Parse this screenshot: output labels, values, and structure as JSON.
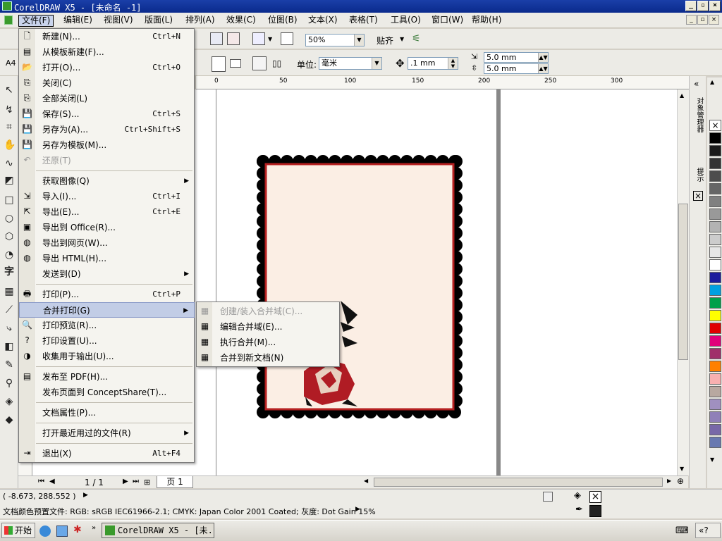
{
  "window": {
    "title": "CorelDRAW X5 - [未命名 -1]"
  },
  "menubar": [
    "文件(F)",
    "编辑(E)",
    "视图(V)",
    "版面(L)",
    "排列(A)",
    "效果(C)",
    "位图(B)",
    "文本(X)",
    "表格(T)",
    "工具(O)",
    "窗口(W)",
    "帮助(H)"
  ],
  "toolbar1": {
    "zoom": "50%",
    "snap_label": "贴齐"
  },
  "toolbar2": {
    "page_size": "A4",
    "units_label": "单位:",
    "units_value": "毫米",
    "nudge": ".1 mm",
    "dup_x": "5.0 mm",
    "dup_y": "5.0 mm"
  },
  "ruler_top_labels": [
    "0",
    "50",
    "100",
    "150",
    "200",
    "250",
    "300"
  ],
  "file_menu": [
    {
      "label": "新建(N)...",
      "shortcut": "Ctrl+N"
    },
    {
      "label": "从模板新建(F)..."
    },
    {
      "label": "打开(O)...",
      "shortcut": "Ctrl+O"
    },
    {
      "label": "关闭(C)"
    },
    {
      "label": "全部关闭(L)"
    },
    {
      "label": "保存(S)...",
      "shortcut": "Ctrl+S"
    },
    {
      "label": "另存为(A)...",
      "shortcut": "Ctrl+Shift+S"
    },
    {
      "label": "另存为模板(M)..."
    },
    {
      "label": "还原(T)",
      "disabled": true
    },
    {
      "label": "获取图像(Q)",
      "submenu": true
    },
    {
      "label": "导入(I)...",
      "shortcut": "Ctrl+I"
    },
    {
      "label": "导出(E)...",
      "shortcut": "Ctrl+E"
    },
    {
      "label": "导出到 Office(R)..."
    },
    {
      "label": "导出到网页(W)..."
    },
    {
      "label": "导出 HTML(H)..."
    },
    {
      "label": "发送到(D)",
      "submenu": true
    },
    {
      "label": "打印(P)...",
      "shortcut": "Ctrl+P"
    },
    {
      "label": "合并打印(G)",
      "submenu": true,
      "highlighted": true
    },
    {
      "label": "打印预览(R)..."
    },
    {
      "label": "打印设置(U)..."
    },
    {
      "label": "收集用于输出(U)..."
    },
    {
      "label": "发布至 PDF(H)..."
    },
    {
      "label": "发布页面到 ConceptShare(T)..."
    },
    {
      "label": "文档属性(P)..."
    },
    {
      "label": "打开最近用过的文件(R)",
      "submenu": true
    },
    {
      "label": "退出(X)",
      "shortcut": "Alt+F4"
    }
  ],
  "merge_submenu": [
    {
      "label": "创建/装入合并域(C)...",
      "disabled": true
    },
    {
      "label": "编辑合并域(E)..."
    },
    {
      "label": "执行合并(M)..."
    },
    {
      "label": "合并到新文档(N)"
    }
  ],
  "docker_tabs": [
    "对象管理器",
    "提示"
  ],
  "page_nav": {
    "count": "1 / 1",
    "tab": "页 1"
  },
  "status": {
    "coords": "( -8.673, 288.552 )",
    "profile": "文档颜色预置文件: RGB: sRGB IEC61966-2.1; CMYK: Japan Color 2001 Coated; 灰度: Dot Gain 15%"
  },
  "taskbar": {
    "start": "开始",
    "item": "CorelDRAW X5 - [未..."
  },
  "palette_colors": [
    "#ffffff",
    "#000000",
    "#1a1a1a",
    "#333333",
    "#4d4d4d",
    "#666666",
    "#808080",
    "#999999",
    "#b3b3b3",
    "#cccccc",
    "#e6e6e6",
    "#ffffff",
    "#1c1c9c",
    "#00a0e0",
    "#00a04a",
    "#ffff00",
    "#e00000",
    "#e0007a",
    "#a0306a",
    "#ff8000",
    "#f8b0b0",
    "#b8a8a0",
    "#a090c0",
    "#9080b8",
    "#7868a8",
    "#6878b0"
  ]
}
